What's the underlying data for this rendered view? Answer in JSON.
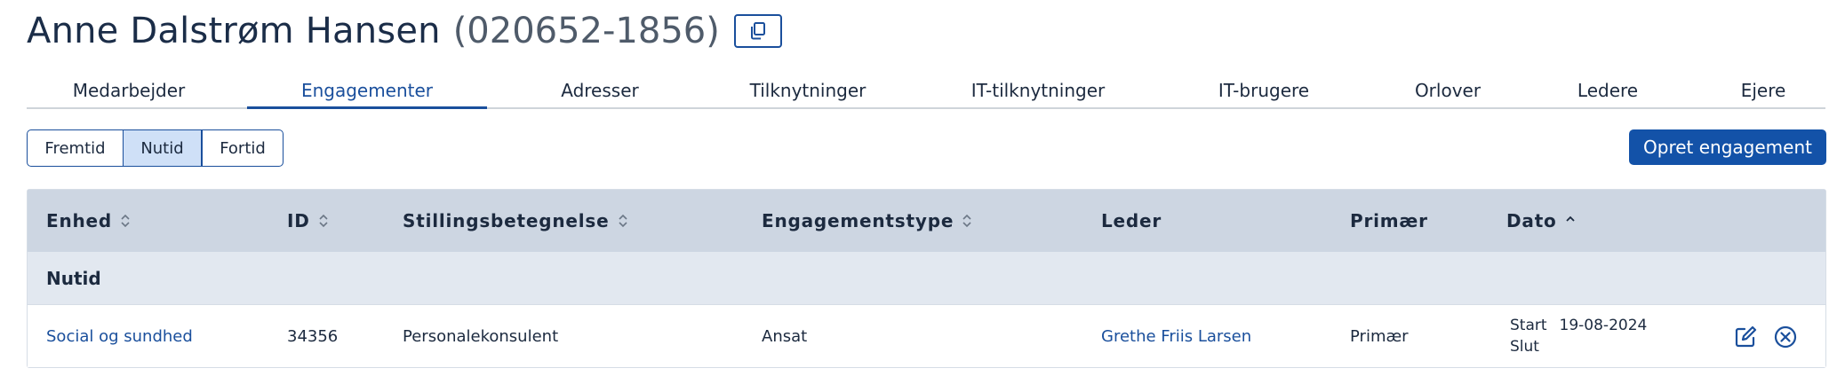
{
  "header": {
    "name": "Anne Dalstrøm Hansen",
    "cpr": "(020652-1856)",
    "copy_icon": "copy-icon"
  },
  "tabs": [
    {
      "label": "Medarbejder",
      "active": false
    },
    {
      "label": "Engagementer",
      "active": true
    },
    {
      "label": "Adresser",
      "active": false
    },
    {
      "label": "Tilknytninger",
      "active": false
    },
    {
      "label": "IT-tilknytninger",
      "active": false
    },
    {
      "label": "IT-brugere",
      "active": false
    },
    {
      "label": "Orlover",
      "active": false
    },
    {
      "label": "Ledere",
      "active": false
    },
    {
      "label": "Ejere",
      "active": false
    }
  ],
  "time_filter": {
    "options": [
      "Fremtid",
      "Nutid",
      "Fortid"
    ],
    "selected": "Nutid"
  },
  "actions": {
    "create_label": "Opret engagement"
  },
  "table": {
    "columns": [
      {
        "label": "Enhed",
        "sortable": true
      },
      {
        "label": "ID",
        "sortable": true
      },
      {
        "label": "Stillingsbetegnelse",
        "sortable": true
      },
      {
        "label": "Engagementstype",
        "sortable": true
      },
      {
        "label": "Leder",
        "sortable": false
      },
      {
        "label": "Primær",
        "sortable": false
      },
      {
        "label": "Dato",
        "sortable": true
      }
    ],
    "group_label": "Nutid",
    "rows": [
      {
        "enhed": "Social og sundhed",
        "id": "34356",
        "stilling": "Personalekonsulent",
        "type": "Ansat",
        "leder": "Grethe Friis Larsen",
        "primaer": "Primær",
        "start_label": "Start",
        "start_date": "19-08-2024",
        "slut_label": "Slut",
        "slut_date": ""
      }
    ]
  },
  "colors": {
    "accent": "#1a4f9c",
    "primary_button": "#1352a8",
    "header_bg": "#cdd6e2",
    "group_bg": "#e2e8f0"
  }
}
